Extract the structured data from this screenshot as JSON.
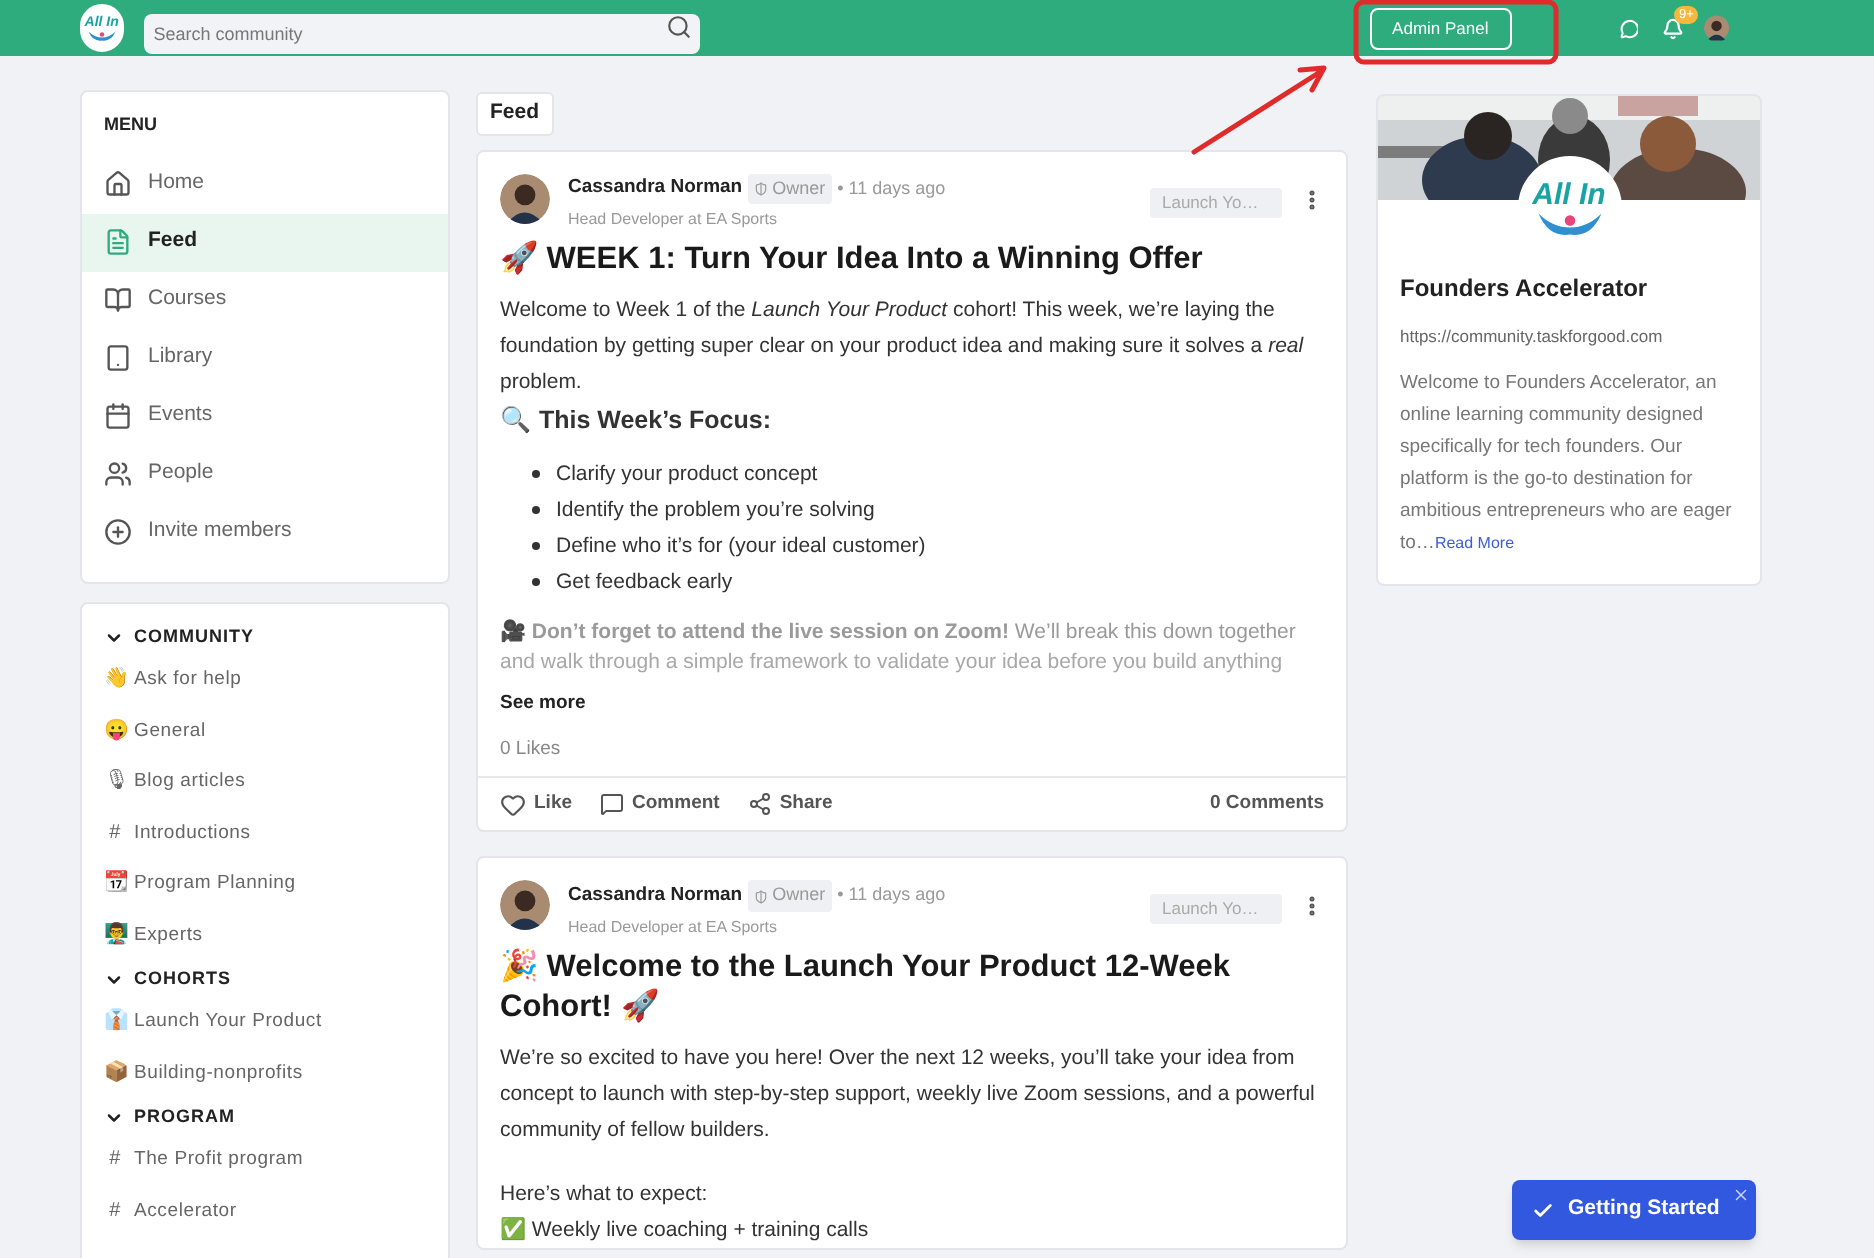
{
  "header": {
    "logo": "All In",
    "search_placeholder": "Search community",
    "admin_button": "Admin Panel",
    "notification_badge": "9+"
  },
  "menu": {
    "title": "MENU",
    "items": [
      {
        "label": "Home",
        "selected": false
      },
      {
        "label": "Feed",
        "selected": true
      },
      {
        "label": "Courses",
        "selected": false
      },
      {
        "label": "Library",
        "selected": false
      },
      {
        "label": "Events",
        "selected": false
      },
      {
        "label": "People",
        "selected": false
      },
      {
        "label": "Invite members",
        "selected": false
      }
    ]
  },
  "sections": [
    {
      "title": "COMMUNITY",
      "expanded": true,
      "items": [
        {
          "icon": "👋",
          "label": "Ask for help"
        },
        {
          "icon": "😛",
          "label": "General"
        },
        {
          "icon": "🎙",
          "label": "Blog articles"
        },
        {
          "icon": "#",
          "label": "Introductions"
        },
        {
          "icon": "📆",
          "label": "Program Planning"
        },
        {
          "icon": "👨‍🏫",
          "label": "Experts"
        }
      ]
    },
    {
      "title": "COHORTS",
      "expanded": true,
      "items": [
        {
          "icon": "👔",
          "label": "Launch Your Product"
        },
        {
          "icon": "📦",
          "label": "Building-nonprofits"
        }
      ]
    },
    {
      "title": "PROGRAM",
      "expanded": true,
      "items": [
        {
          "icon": "#",
          "label": "The Profit program"
        },
        {
          "icon": "#",
          "label": "Accelerator"
        }
      ]
    }
  ],
  "feed": {
    "title": "Feed",
    "posts": [
      {
        "author": "Cassandra Norman",
        "badge": "Owner",
        "time": "• 11 days ago",
        "subtitle": "Head Developer at EA Sports",
        "tag": "Launch Yo…",
        "title": "🚀 WEEK 1: Turn Your Idea Into a Winning Offer",
        "blocks": [
          {
            "kind": "paragraph",
            "text": "Welcome to Week 1 of the *Launch Your Product* cohort! This week, we’re laying the foundation by getting super clear on your product idea and making sure it solves a *real* problem."
          },
          {
            "kind": "heading",
            "text": "🔍 This Week’s Focus:"
          },
          {
            "kind": "bullets",
            "items": [
              "Clarify your product concept",
              "Identify the problem you’re solving",
              "Define who it’s for (your ideal customer)",
              "Get feedback early"
            ]
          },
          {
            "kind": "faded",
            "text": "🎥 **Don’t forget to attend the live session on Zoom!** We’ll break this down together"
          },
          {
            "kind": "faded_more",
            "text": "and walk through a simple framework to validate your idea before you build anything"
          }
        ],
        "footer": {
          "see_more": "See more",
          "likes": "0 Likes",
          "like": "Like",
          "comment": "Comment",
          "share": "Share",
          "comments": "0 Comments"
        }
      },
      {
        "author": "Cassandra Norman",
        "badge": "Owner",
        "time": "• 11 days ago",
        "subtitle": "Head Developer at EA Sports",
        "tag": "Launch Yo…",
        "title": "🎉 Welcome to the Launch Your Product 12-Week Cohort! 🚀",
        "blocks": [
          {
            "kind": "paragraph",
            "text": "We’re so excited to have you here! Over the next 12 weeks, you’ll take your idea from concept to launch with step-by-step support, weekly live Zoom sessions, and a powerful community of fellow builders."
          },
          {
            "kind": "spacer"
          },
          {
            "kind": "line",
            "text": "Here’s what to expect:"
          },
          {
            "kind": "line",
            "text": "✅ Weekly live coaching + training calls"
          }
        ]
      }
    ]
  },
  "about": {
    "logo": "All In",
    "name": "Founders Accelerator",
    "url": "https://community.taskforgood.com",
    "description": "Welcome to Founders Accelerator, an online learning community designed specifically for tech founders. Our platform is the go-to destination for ambitious entrepreneurs who are eager to…",
    "read_more": "Read More"
  },
  "getting_started": {
    "label": "Getting Started"
  }
}
